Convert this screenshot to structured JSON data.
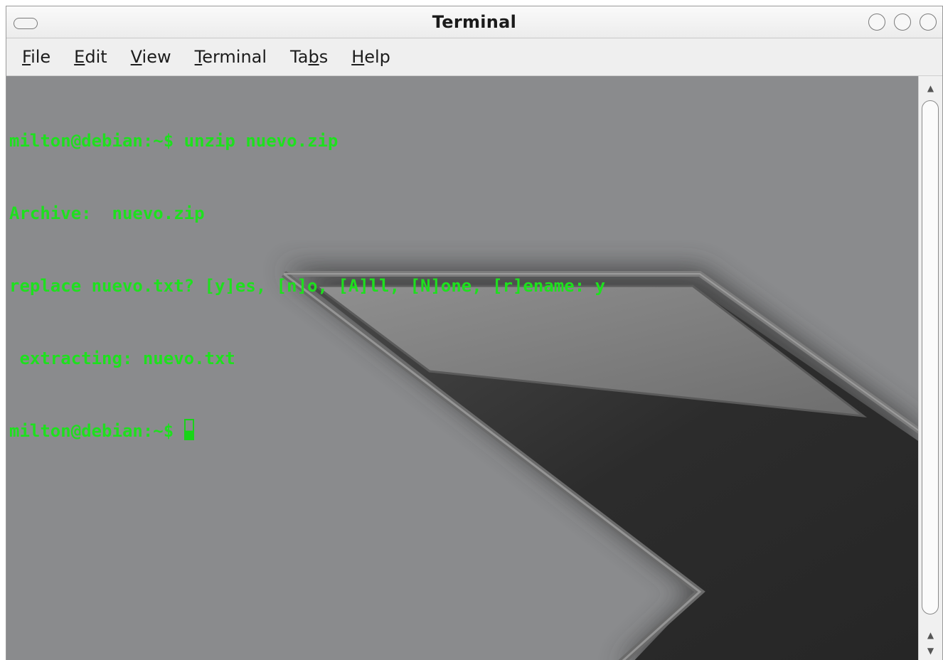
{
  "window": {
    "title": "Terminal"
  },
  "menubar": {
    "items": [
      {
        "pre": "",
        "key": "F",
        "post": "ile"
      },
      {
        "pre": "",
        "key": "E",
        "post": "dit"
      },
      {
        "pre": "",
        "key": "V",
        "post": "iew"
      },
      {
        "pre": "",
        "key": "T",
        "post": "erminal"
      },
      {
        "pre": "Ta",
        "key": "b",
        "post": "s"
      },
      {
        "pre": "",
        "key": "H",
        "post": "elp"
      }
    ]
  },
  "terminal": {
    "lines": [
      "milton@debian:~$ unzip nuevo.zip",
      "Archive:  nuevo.zip",
      "replace nuevo.txt? [y]es, [n]o, [A]ll, [N]one, [r]ename: y",
      " extracting: nuevo.txt"
    ],
    "prompt": "milton@debian:~$ ",
    "text_color": "#1ee01e",
    "background_color": "#8a8b8d"
  },
  "scrollbar": {
    "up_arrow_icon": "▲",
    "down_arrow_icon": "▼"
  }
}
